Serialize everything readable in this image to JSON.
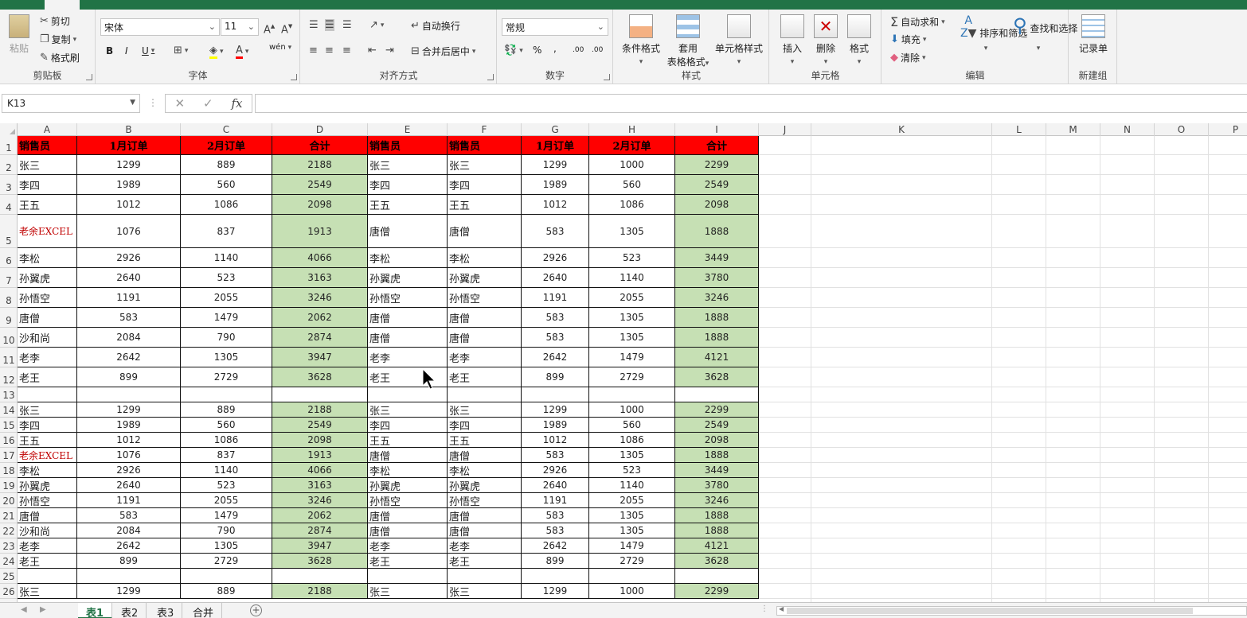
{
  "ribbon": {
    "clipboard": {
      "label": "剪贴板",
      "paste": "粘贴",
      "cut": "剪切",
      "copy": "复制",
      "format_painter": "格式刷"
    },
    "font": {
      "label": "字体",
      "font_name": "宋体",
      "font_size": "11",
      "bold": "B",
      "italic": "I",
      "underline": "U",
      "phonetic": "wén"
    },
    "alignment": {
      "label": "对齐方式",
      "wrap_text": "自动换行",
      "merge_center": "合并后居中"
    },
    "number": {
      "label": "数字",
      "format": "常规",
      "percent": "%",
      "comma": ",",
      "inc_decimal": ".00",
      "dec_decimal": ".00"
    },
    "styles": {
      "label": "样式",
      "conditional": "条件格式",
      "format_table_1": "套用",
      "format_table_2": "表格格式",
      "cell_styles": "单元格样式"
    },
    "cells": {
      "label": "单元格",
      "insert": "插入",
      "delete": "删除",
      "format": "格式"
    },
    "editing": {
      "label": "编辑",
      "autosum": "自动求和",
      "fill": "填充",
      "clear": "清除",
      "sort_filter": "排序和筛选",
      "find_select": "查找和选择"
    },
    "new_group": {
      "label": "新建组",
      "record_form": "记录单"
    }
  },
  "formula_bar": {
    "name_box": "K13",
    "fx": "fx",
    "value": ""
  },
  "columns": [
    {
      "name": "A",
      "w": 75
    },
    {
      "name": "B",
      "w": 130
    },
    {
      "name": "C",
      "w": 115
    },
    {
      "name": "D",
      "w": 120
    },
    {
      "name": "E",
      "w": 100
    },
    {
      "name": "F",
      "w": 93
    },
    {
      "name": "G",
      "w": 85
    },
    {
      "name": "H",
      "w": 108
    },
    {
      "name": "I",
      "w": 105
    },
    {
      "name": "J",
      "w": 66
    },
    {
      "name": "K",
      "w": 227
    },
    {
      "name": "L",
      "w": 68
    },
    {
      "name": "M",
      "w": 68
    },
    {
      "name": "N",
      "w": 68
    },
    {
      "name": "O",
      "w": 68
    },
    {
      "name": "P",
      "w": 68
    }
  ],
  "header_row": [
    "销售员",
    "1月订单",
    "2月订单",
    "合计",
    "销售员",
    "销售员",
    "1月订单",
    "2月订单",
    "合计"
  ],
  "rows": [
    {
      "n": "1",
      "h": 24,
      "header": true
    },
    {
      "n": "2",
      "h": 25,
      "c": [
        "张三",
        "1299",
        "889",
        "2188",
        "张三",
        "张三",
        "1299",
        "1000",
        "2299"
      ]
    },
    {
      "n": "3",
      "h": 25,
      "c": [
        "李四",
        "1989",
        "560",
        "2549",
        "李四",
        "李四",
        "1989",
        "560",
        "2549"
      ]
    },
    {
      "n": "4",
      "h": 25,
      "c": [
        "王五",
        "1012",
        "1086",
        "2098",
        "王五",
        "王五",
        "1012",
        "1086",
        "2098"
      ]
    },
    {
      "n": "5",
      "h": 42,
      "c": [
        "老余EXCEL",
        "1076",
        "837",
        "1913",
        "唐僧",
        "唐僧",
        "583",
        "1305",
        "1888"
      ],
      "red": true
    },
    {
      "n": "6",
      "h": 25,
      "c": [
        "李松",
        "2926",
        "1140",
        "4066",
        "李松",
        "李松",
        "2926",
        "523",
        "3449"
      ]
    },
    {
      "n": "7",
      "h": 25,
      "c": [
        "孙翼虎",
        "2640",
        "523",
        "3163",
        "孙翼虎",
        "孙翼虎",
        "2640",
        "1140",
        "3780"
      ]
    },
    {
      "n": "8",
      "h": 25,
      "c": [
        "孙悟空",
        "1191",
        "2055",
        "3246",
        "孙悟空",
        "孙悟空",
        "1191",
        "2055",
        "3246"
      ]
    },
    {
      "n": "9",
      "h": 25,
      "c": [
        "唐僧",
        "583",
        "1479",
        "2062",
        "唐僧",
        "唐僧",
        "583",
        "1305",
        "1888"
      ]
    },
    {
      "n": "10",
      "h": 25,
      "c": [
        "沙和尚",
        "2084",
        "790",
        "2874",
        "唐僧",
        "唐僧",
        "583",
        "1305",
        "1888"
      ]
    },
    {
      "n": "11",
      "h": 25,
      "c": [
        "老李",
        "2642",
        "1305",
        "3947",
        "老李",
        "老李",
        "2642",
        "1479",
        "4121"
      ]
    },
    {
      "n": "12",
      "h": 25,
      "c": [
        "老王",
        "899",
        "2729",
        "3628",
        "老王",
        "老王",
        "899",
        "2729",
        "3628"
      ]
    },
    {
      "n": "13",
      "h": 19,
      "c": [
        "",
        "",
        "",
        "",
        "",
        "",
        "",
        "",
        ""
      ],
      "blank": true
    },
    {
      "n": "14",
      "h": 19,
      "c": [
        "张三",
        "1299",
        "889",
        "2188",
        "张三",
        "张三",
        "1299",
        "1000",
        "2299"
      ]
    },
    {
      "n": "15",
      "h": 19,
      "c": [
        "李四",
        "1989",
        "560",
        "2549",
        "李四",
        "李四",
        "1989",
        "560",
        "2549"
      ]
    },
    {
      "n": "16",
      "h": 19,
      "c": [
        "王五",
        "1012",
        "1086",
        "2098",
        "王五",
        "王五",
        "1012",
        "1086",
        "2098"
      ]
    },
    {
      "n": "17",
      "h": 19,
      "c": [
        "老余EXCEL",
        "1076",
        "837",
        "1913",
        "唐僧",
        "唐僧",
        "583",
        "1305",
        "1888"
      ],
      "red": true
    },
    {
      "n": "18",
      "h": 19,
      "c": [
        "李松",
        "2926",
        "1140",
        "4066",
        "李松",
        "李松",
        "2926",
        "523",
        "3449"
      ]
    },
    {
      "n": "19",
      "h": 19,
      "c": [
        "孙翼虎",
        "2640",
        "523",
        "3163",
        "孙翼虎",
        "孙翼虎",
        "2640",
        "1140",
        "3780"
      ]
    },
    {
      "n": "20",
      "h": 19,
      "c": [
        "孙悟空",
        "1191",
        "2055",
        "3246",
        "孙悟空",
        "孙悟空",
        "1191",
        "2055",
        "3246"
      ]
    },
    {
      "n": "21",
      "h": 19,
      "c": [
        "唐僧",
        "583",
        "1479",
        "2062",
        "唐僧",
        "唐僧",
        "583",
        "1305",
        "1888"
      ]
    },
    {
      "n": "22",
      "h": 19,
      "c": [
        "沙和尚",
        "2084",
        "790",
        "2874",
        "唐僧",
        "唐僧",
        "583",
        "1305",
        "1888"
      ]
    },
    {
      "n": "23",
      "h": 19,
      "c": [
        "老李",
        "2642",
        "1305",
        "3947",
        "老李",
        "老李",
        "2642",
        "1479",
        "4121"
      ]
    },
    {
      "n": "24",
      "h": 19,
      "c": [
        "老王",
        "899",
        "2729",
        "3628",
        "老王",
        "老王",
        "899",
        "2729",
        "3628"
      ]
    },
    {
      "n": "25",
      "h": 19,
      "c": [
        "",
        "",
        "",
        "",
        "",
        "",
        "",
        "",
        ""
      ],
      "blank": true
    },
    {
      "n": "26",
      "h": 19,
      "c": [
        "张三",
        "1299",
        "889",
        "2188",
        "张三",
        "张三",
        "1299",
        "1000",
        "2299"
      ]
    }
  ],
  "sheets": [
    {
      "name": "表1",
      "active": true
    },
    {
      "name": "表2",
      "active": false
    },
    {
      "name": "表3",
      "active": false
    },
    {
      "name": "合并",
      "active": false
    }
  ],
  "colors": {
    "header_fill": "#ff0000",
    "sum_fill": "#c6e0b4",
    "accent": "#217346",
    "red_text": "#c00000"
  }
}
